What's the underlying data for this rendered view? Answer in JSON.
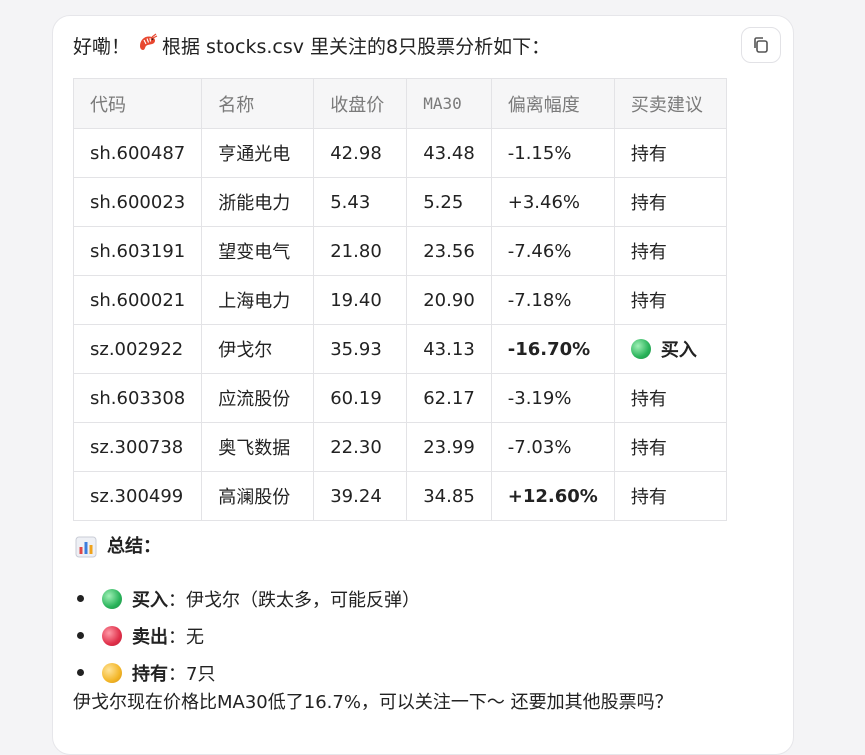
{
  "message": {
    "greeting": "好嘞！",
    "intro_text": "根据 stocks.csv 里关注的8只股票分析如下：",
    "shrimp_emoji": "🦐"
  },
  "table": {
    "headers": [
      "代码",
      "名称",
      "收盘价",
      "MA30",
      "偏离幅度",
      "买卖建议"
    ],
    "rows": [
      {
        "code": "sh.600487",
        "name": "亨通光电",
        "close": "42.98",
        "ma30": "43.48",
        "deviation": "-1.15%",
        "advice": "持有"
      },
      {
        "code": "sh.600023",
        "name": "浙能电力",
        "close": "5.43",
        "ma30": "5.25",
        "deviation": "+3.46%",
        "advice": "持有"
      },
      {
        "code": "sh.603191",
        "name": "望变电气",
        "close": "21.80",
        "ma30": "23.56",
        "deviation": "-7.46%",
        "advice": "持有"
      },
      {
        "code": "sh.600021",
        "name": "上海电力",
        "close": "19.40",
        "ma30": "20.90",
        "deviation": "-7.18%",
        "advice": "持有"
      },
      {
        "code": "sz.002922",
        "name": "伊戈尔",
        "close": "35.93",
        "ma30": "43.13",
        "deviation": "-16.70%",
        "advice": "买入"
      },
      {
        "code": "sh.603308",
        "name": "应流股份",
        "close": "60.19",
        "ma30": "62.17",
        "deviation": "-3.19%",
        "advice": "持有"
      },
      {
        "code": "sz.300738",
        "name": "奥飞数据",
        "close": "22.30",
        "ma30": "23.99",
        "deviation": "-7.03%",
        "advice": "持有"
      },
      {
        "code": "sz.300499",
        "name": "高澜股份",
        "close": "39.24",
        "ma30": "34.85",
        "deviation": "+12.60%",
        "advice": "持有"
      }
    ]
  },
  "summary": {
    "title": "总结：",
    "items": [
      {
        "label": "买入",
        "text": "：伊戈尔（跌太多，可能反弹）",
        "color": "#29b35a"
      },
      {
        "label": "卖出",
        "text": "：无",
        "color": "#e0304a"
      },
      {
        "label": "持有",
        "text": "：7只",
        "color": "#f3b628"
      }
    ]
  },
  "closing": "伊戈尔现在价格比MA30低了16.7%，可以关注一下～ 还要加其他股票吗？",
  "icons": {
    "copy": "copy-icon",
    "chart": "bar-chart-icon"
  }
}
